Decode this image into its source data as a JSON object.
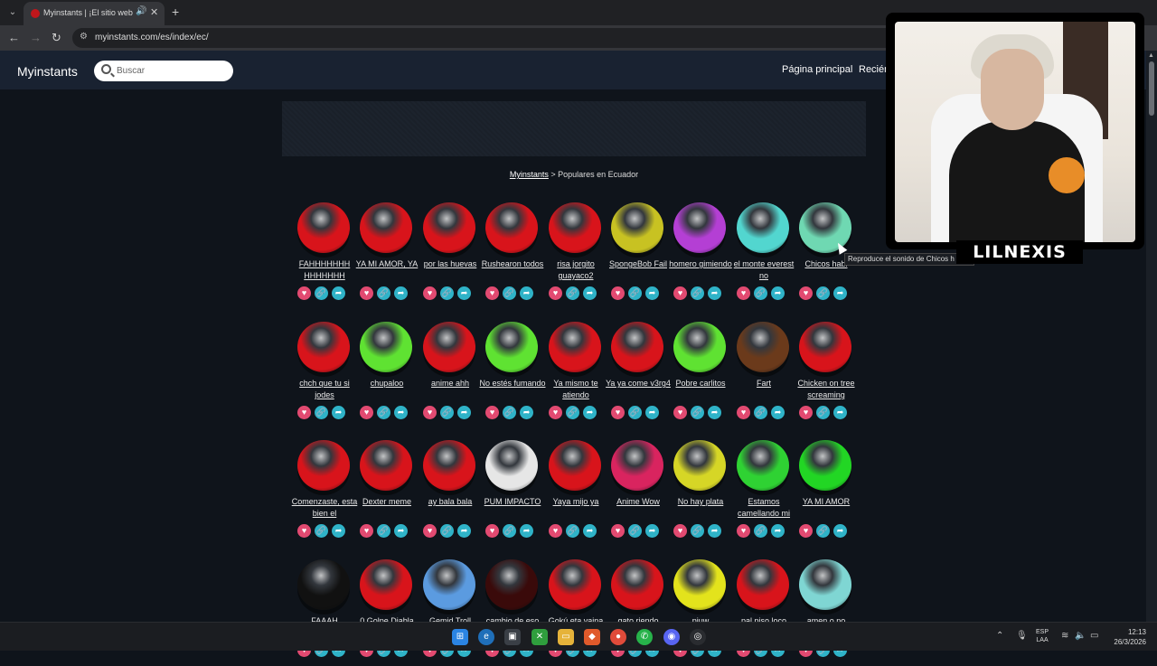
{
  "browser": {
    "tab_title": "Myinstants | ¡El sitio web de",
    "url": "myinstants.com/es/index/ec/"
  },
  "site": {
    "logo": "Myinstants",
    "search_placeholder": "Buscar",
    "nav": [
      "Página principal",
      "Recién"
    ]
  },
  "breadcrumb": {
    "home": "Myinstants",
    "separator": " > ",
    "current": "Populares en Ecuador"
  },
  "tooltip": "Reproduce el sonido de Chicos h",
  "sounds": [
    {
      "label": "FAHHHHHHH HHHHHHH",
      "color": "#d8141b"
    },
    {
      "label": "YA MI AMOR, YA",
      "color": "#d8141b"
    },
    {
      "label": "por las huevas",
      "color": "#d8141b"
    },
    {
      "label": "Rushearon todos",
      "color": "#d8141b"
    },
    {
      "label": "risa jorgito guayaco2",
      "color": "#d8141b"
    },
    {
      "label": "SpongeBob Fail",
      "color": "#c8c222"
    },
    {
      "label": "homero gimiendo",
      "color": "#b43fd4"
    },
    {
      "label": "el monte everest no",
      "color": "#52d6cf"
    },
    {
      "label": "Chicos habl",
      "color": "#6fd8b2"
    },
    {
      "label": "chch que tu si jodes",
      "color": "#d8141b"
    },
    {
      "label": "chupaloo",
      "color": "#5fe232"
    },
    {
      "label": "anime ahh",
      "color": "#d8141b"
    },
    {
      "label": "No estés fumando",
      "color": "#5fe232"
    },
    {
      "label": "Ya mismo te atiendo",
      "color": "#d8141b"
    },
    {
      "label": "Ya ya come v3rg4",
      "color": "#d8141b"
    },
    {
      "label": "Pobre carlitos",
      "color": "#5fe232"
    },
    {
      "label": "Fart",
      "color": "#6b3a1b"
    },
    {
      "label": "Chicken on tree screaming",
      "color": "#d8141b"
    },
    {
      "label": "Comenzaste, esta bien el",
      "color": "#d8141b"
    },
    {
      "label": "Dexter meme",
      "color": "#d8141b"
    },
    {
      "label": "ay bala bala",
      "color": "#d8141b"
    },
    {
      "label": "PUM IMPACTO",
      "color": "#e6e6e6"
    },
    {
      "label": "Yaya mijo ya",
      "color": "#d8141b"
    },
    {
      "label": "Anime Wow",
      "color": "#d9245f"
    },
    {
      "label": "No hay plata",
      "color": "#d6d626"
    },
    {
      "label": "Estamos camellando mi",
      "color": "#2fd233"
    },
    {
      "label": "YA MI AMOR",
      "color": "#22d624"
    },
    {
      "label": "FAAAH",
      "color": "#111111"
    },
    {
      "label": "0 Golpe Diabla",
      "color": "#d8141b"
    },
    {
      "label": "Gemid Troll",
      "color": "#5b9be0"
    },
    {
      "label": "cambio de eso",
      "color": "#3a0a0a"
    },
    {
      "label": "Gokú eta vaina",
      "color": "#d8141b"
    },
    {
      "label": "gato riendo",
      "color": "#d8141b"
    },
    {
      "label": "piuw",
      "color": "#e3e31c"
    },
    {
      "label": "pal piso loco",
      "color": "#d8141b"
    },
    {
      "label": "amen o no",
      "color": "#7fd6d3"
    }
  ],
  "webcam": {
    "name": "LILNEXIS"
  },
  "taskbar": {
    "lang_top": "ESP",
    "lang_bottom": "LAA",
    "time": "12:13",
    "date": "26/3/2026"
  }
}
